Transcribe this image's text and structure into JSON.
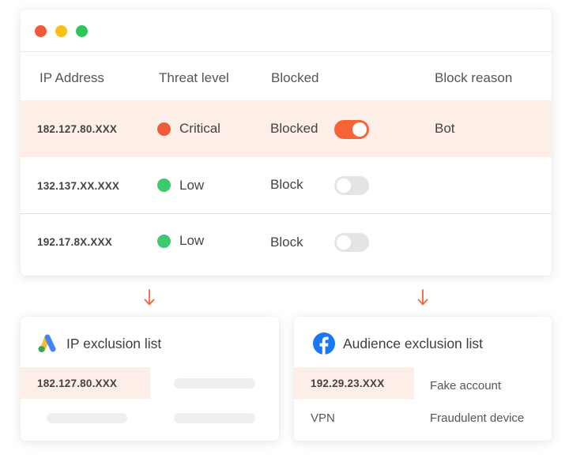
{
  "colors": {
    "mac_close": "#f05a37",
    "mac_minimize": "#f7c01b",
    "mac_maximize": "#2ec55a",
    "critical": "#f25a3c",
    "low": "#3ec96e",
    "toggle_on": "#f86237",
    "toggle_off": "#e4e4e4",
    "highlight_row": "#fdeee7",
    "arrow": "#f86237"
  },
  "table": {
    "headers": {
      "ip": "IP Address",
      "threat": "Threat level",
      "blocked": "Blocked",
      "reason": "Block reason"
    },
    "rows": [
      {
        "ip": "182.127.80.XXX",
        "threat": "Critical",
        "blocked_label": "Blocked",
        "toggle": "on",
        "reason": "Bot"
      },
      {
        "ip": "132.137.XX.XXX",
        "threat": "Low",
        "blocked_label": "Block",
        "toggle": "off",
        "reason": ""
      },
      {
        "ip": "192.17.8X.XXX",
        "threat": "Low",
        "blocked_label": "Block",
        "toggle": "off",
        "reason": ""
      }
    ]
  },
  "ip_exclusion": {
    "icon": "google-ads-icon",
    "title": "IP exclusion list",
    "entry": "182.127.80.XXX"
  },
  "audience_exclusion": {
    "icon": "facebook-icon",
    "title": "Audience exclusion list",
    "rows": [
      {
        "left": "192.29.23.XXX",
        "right": "Fake account"
      },
      {
        "left": "VPN",
        "right": "Fraudulent device"
      }
    ]
  }
}
